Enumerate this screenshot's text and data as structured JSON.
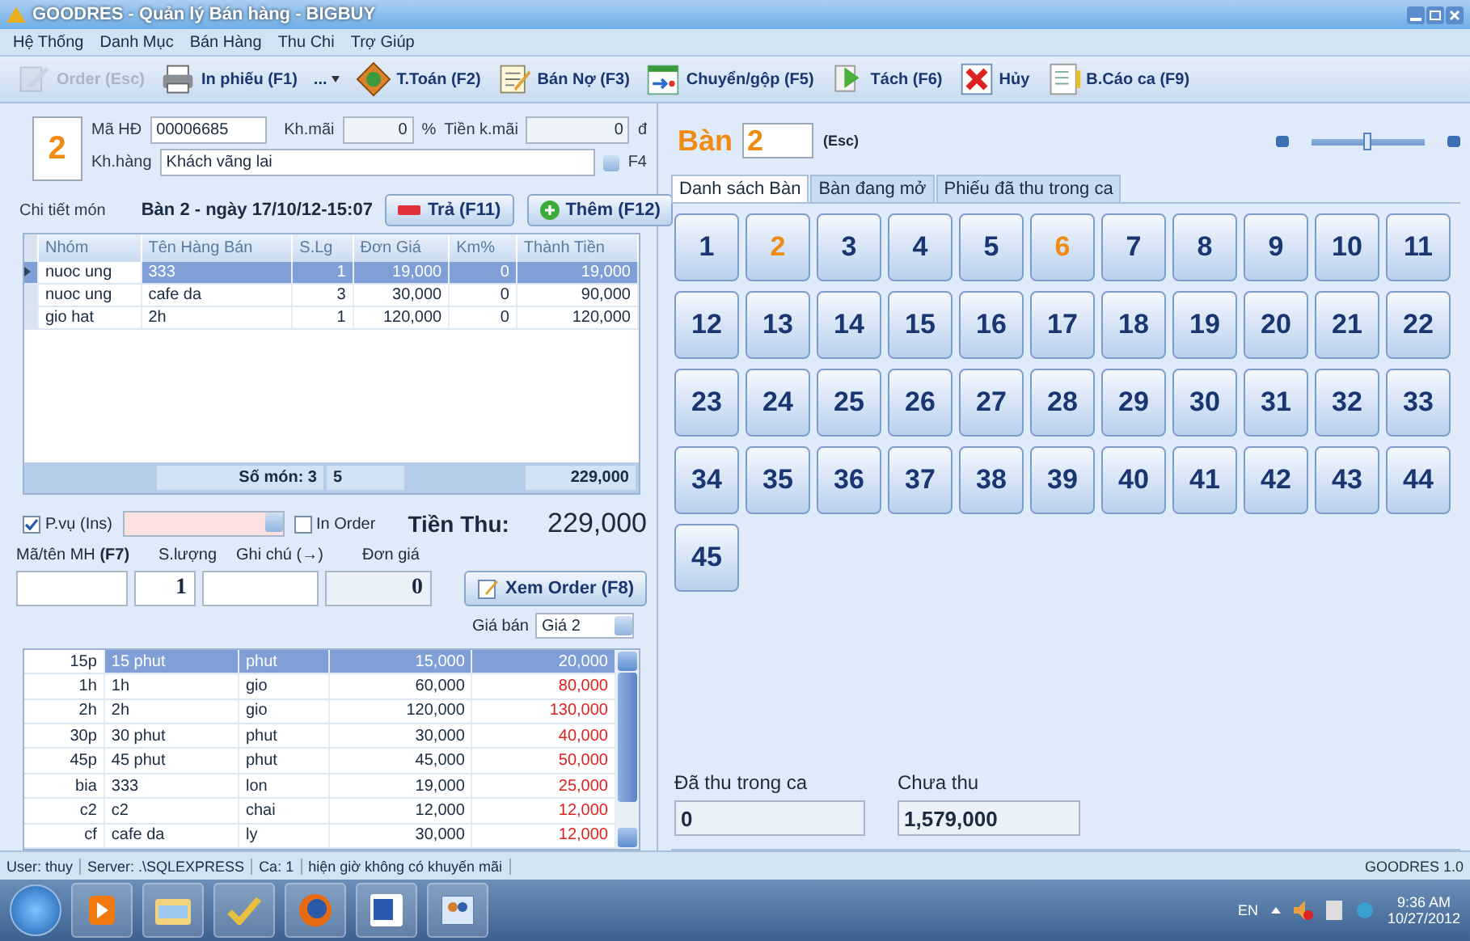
{
  "window": {
    "title": "GOODRES - Quản lý Bán hàng - BIGBUY"
  },
  "menu": [
    "Hệ Thống",
    "Danh Mục",
    "Bán Hàng",
    "Thu Chi",
    "Trợ Giúp"
  ],
  "toolbar": [
    {
      "label": "Order (Esc)",
      "kind": "edit",
      "disabled": true
    },
    {
      "label": "In phiếu (F1)",
      "kind": "printer",
      "disabled": false
    },
    {
      "label": "...",
      "kind": "dropdown",
      "disabled": false
    },
    {
      "label": "T.Toán (F2)",
      "kind": "money",
      "disabled": false
    },
    {
      "label": "Bán Nợ (F3)",
      "kind": "note",
      "disabled": false
    },
    {
      "label": "Chuyển/gộp (F5)",
      "kind": "calendar",
      "disabled": false
    },
    {
      "label": "Tách (F6)",
      "kind": "split",
      "disabled": false
    },
    {
      "label": "Hủy",
      "kind": "cancel",
      "disabled": false
    },
    {
      "label": "B.Cáo ca (F9)",
      "kind": "report",
      "disabled": false
    }
  ],
  "order": {
    "table_number": "2",
    "invoice_label": "Mã HĐ",
    "invoice": "00006685",
    "discount_label": "Kh.mãi",
    "discount": "0",
    "discount_unit": "%",
    "discount_amount_label": "Tiền k.mãi",
    "discount_amount": "0",
    "currency": "đ",
    "customer_label": "Kh.hàng",
    "customer": "Khách vãng lai",
    "customer_key": "F4",
    "detail_label": "Chi tiết món",
    "detail_title": "Bàn 2 - ngày 17/10/12-15:07",
    "return_button": "Trả (F11)",
    "add_button": "Thêm (F12)",
    "columns": [
      "Nhóm",
      "Tên Hàng Bán",
      "S.Lg",
      "Đơn Giá",
      "Km%",
      "Thành Tiền"
    ],
    "rows": [
      {
        "cells": [
          "nuoc ung",
          "333",
          "1",
          "19,000",
          "0",
          "19,000"
        ],
        "selected": true
      },
      {
        "cells": [
          "nuoc ung",
          "cafe da",
          "3",
          "30,000",
          "0",
          "90,000"
        ],
        "selected": false
      },
      {
        "cells": [
          "gio hat",
          "2h",
          "1",
          "120,000",
          "0",
          "120,000"
        ],
        "selected": false
      }
    ],
    "footer": {
      "count": "Số món: 3",
      "quantity": "5",
      "total": "229,000"
    }
  },
  "entry": {
    "service_label": "P.vụ (Ins)",
    "service_checked": true,
    "print_order_label": "In Order",
    "print_order_checked": false,
    "total_label": "Tiền Thu:",
    "total": "229,000",
    "item_label": "Mã/tên MH **(F7)**",
    "quantity_label": "S.lượng",
    "note_label": "Ghi chú (→)",
    "price_label": "Đơn giá",
    "quantity": "1",
    "price": "0",
    "view_order_button": "Xem Order (F8)",
    "price_level_label": "Giá bán",
    "price_level": "Giá 2"
  },
  "price_list": [
    {
      "cells": [
        "15p",
        "15 phut",
        "phut",
        "15,000",
        "20,000"
      ],
      "selected": true
    },
    {
      "cells": [
        "1h",
        "1h",
        "gio",
        "60,000",
        "80,000"
      ],
      "selected": false
    },
    {
      "cells": [
        "2h",
        "2h",
        "gio",
        "120,000",
        "130,000"
      ],
      "selected": false
    },
    {
      "cells": [
        "30p",
        "30 phut",
        "phut",
        "30,000",
        "40,000"
      ],
      "selected": false
    },
    {
      "cells": [
        "45p",
        "45 phut",
        "phut",
        "45,000",
        "50,000"
      ],
      "selected": false
    },
    {
      "cells": [
        "bia",
        "333",
        "lon",
        "19,000",
        "25,000"
      ],
      "selected": false
    },
    {
      "cells": [
        "c2",
        "c2",
        "chai",
        "12,000",
        "12,000"
      ],
      "selected": false
    },
    {
      "cells": [
        "cf",
        "cafe da",
        "ly",
        "30,000",
        "12,000"
      ],
      "selected": false
    }
  ],
  "tables_panel": {
    "label": "Bàn",
    "current": "2",
    "escape": "(Esc)",
    "zoom": {
      "level": 0.5
    },
    "tabs": [
      {
        "label": "Danh sách Bàn",
        "selected": true
      },
      {
        "label": "Bàn đang mở",
        "selected": false
      },
      {
        "label": "Phiếu đã thu trong ca",
        "selected": false
      }
    ],
    "tables": [
      {
        "label": "1",
        "occupied": false
      },
      {
        "label": "2",
        "occupied": true
      },
      {
        "label": "3",
        "occupied": false
      },
      {
        "label": "4",
        "occupied": false
      },
      {
        "label": "5",
        "occupied": false
      },
      {
        "label": "6",
        "occupied": true
      },
      {
        "label": "7",
        "occupied": false
      },
      {
        "label": "8",
        "occupied": false
      },
      {
        "label": "9",
        "occupied": false
      },
      {
        "label": "10",
        "occupied": false
      },
      {
        "label": "11",
        "occupied": false
      },
      {
        "label": "12",
        "occupied": false
      },
      {
        "label": "13",
        "occupied": false
      },
      {
        "label": "14",
        "occupied": false
      },
      {
        "label": "15",
        "occupied": false
      },
      {
        "label": "16",
        "occupied": false
      },
      {
        "label": "17",
        "occupied": false
      },
      {
        "label": "18",
        "occupied": false
      },
      {
        "label": "19",
        "occupied": false
      },
      {
        "label": "20",
        "occupied": false
      },
      {
        "label": "21",
        "occupied": false
      },
      {
        "label": "22",
        "occupied": false
      },
      {
        "label": "23",
        "occupied": false
      },
      {
        "label": "24",
        "occupied": false
      },
      {
        "label": "25",
        "occupied": false
      },
      {
        "label": "26",
        "occupied": false
      },
      {
        "label": "27",
        "occupied": false
      },
      {
        "label": "28",
        "occupied": false
      },
      {
        "label": "29",
        "occupied": false
      },
      {
        "label": "30",
        "occupied": false
      },
      {
        "label": "31",
        "occupied": false
      },
      {
        "label": "32",
        "occupied": false
      },
      {
        "label": "33",
        "occupied": false
      },
      {
        "label": "34",
        "occupied": false
      },
      {
        "label": "35",
        "occupied": false
      },
      {
        "label": "36",
        "occupied": false
      },
      {
        "label": "37",
        "occupied": false
      },
      {
        "label": "38",
        "occupied": false
      },
      {
        "label": "39",
        "occupied": false
      },
      {
        "label": "40",
        "occupied": false
      },
      {
        "label": "41",
        "occupied": false
      },
      {
        "label": "42",
        "occupied": false
      },
      {
        "label": "43",
        "occupied": false
      },
      {
        "label": "44",
        "occupied": false
      },
      {
        "label": "45",
        "occupied": false
      }
    ],
    "collected_label": "Đã thu trong ca",
    "collected": "0",
    "uncollected_label": "Chưa thu",
    "uncollected": "1,579,000"
  },
  "status_bar": {
    "items": [
      "User: thuy",
      "Server: .\\SQLEXPRESS",
      "Ca: 1",
      "hiện giờ không có khuyến mãi"
    ],
    "version": "GOODRES 1.0"
  },
  "taskbar": {
    "language": "EN",
    "time": "9:36 AM",
    "date": "10/27/2012"
  }
}
